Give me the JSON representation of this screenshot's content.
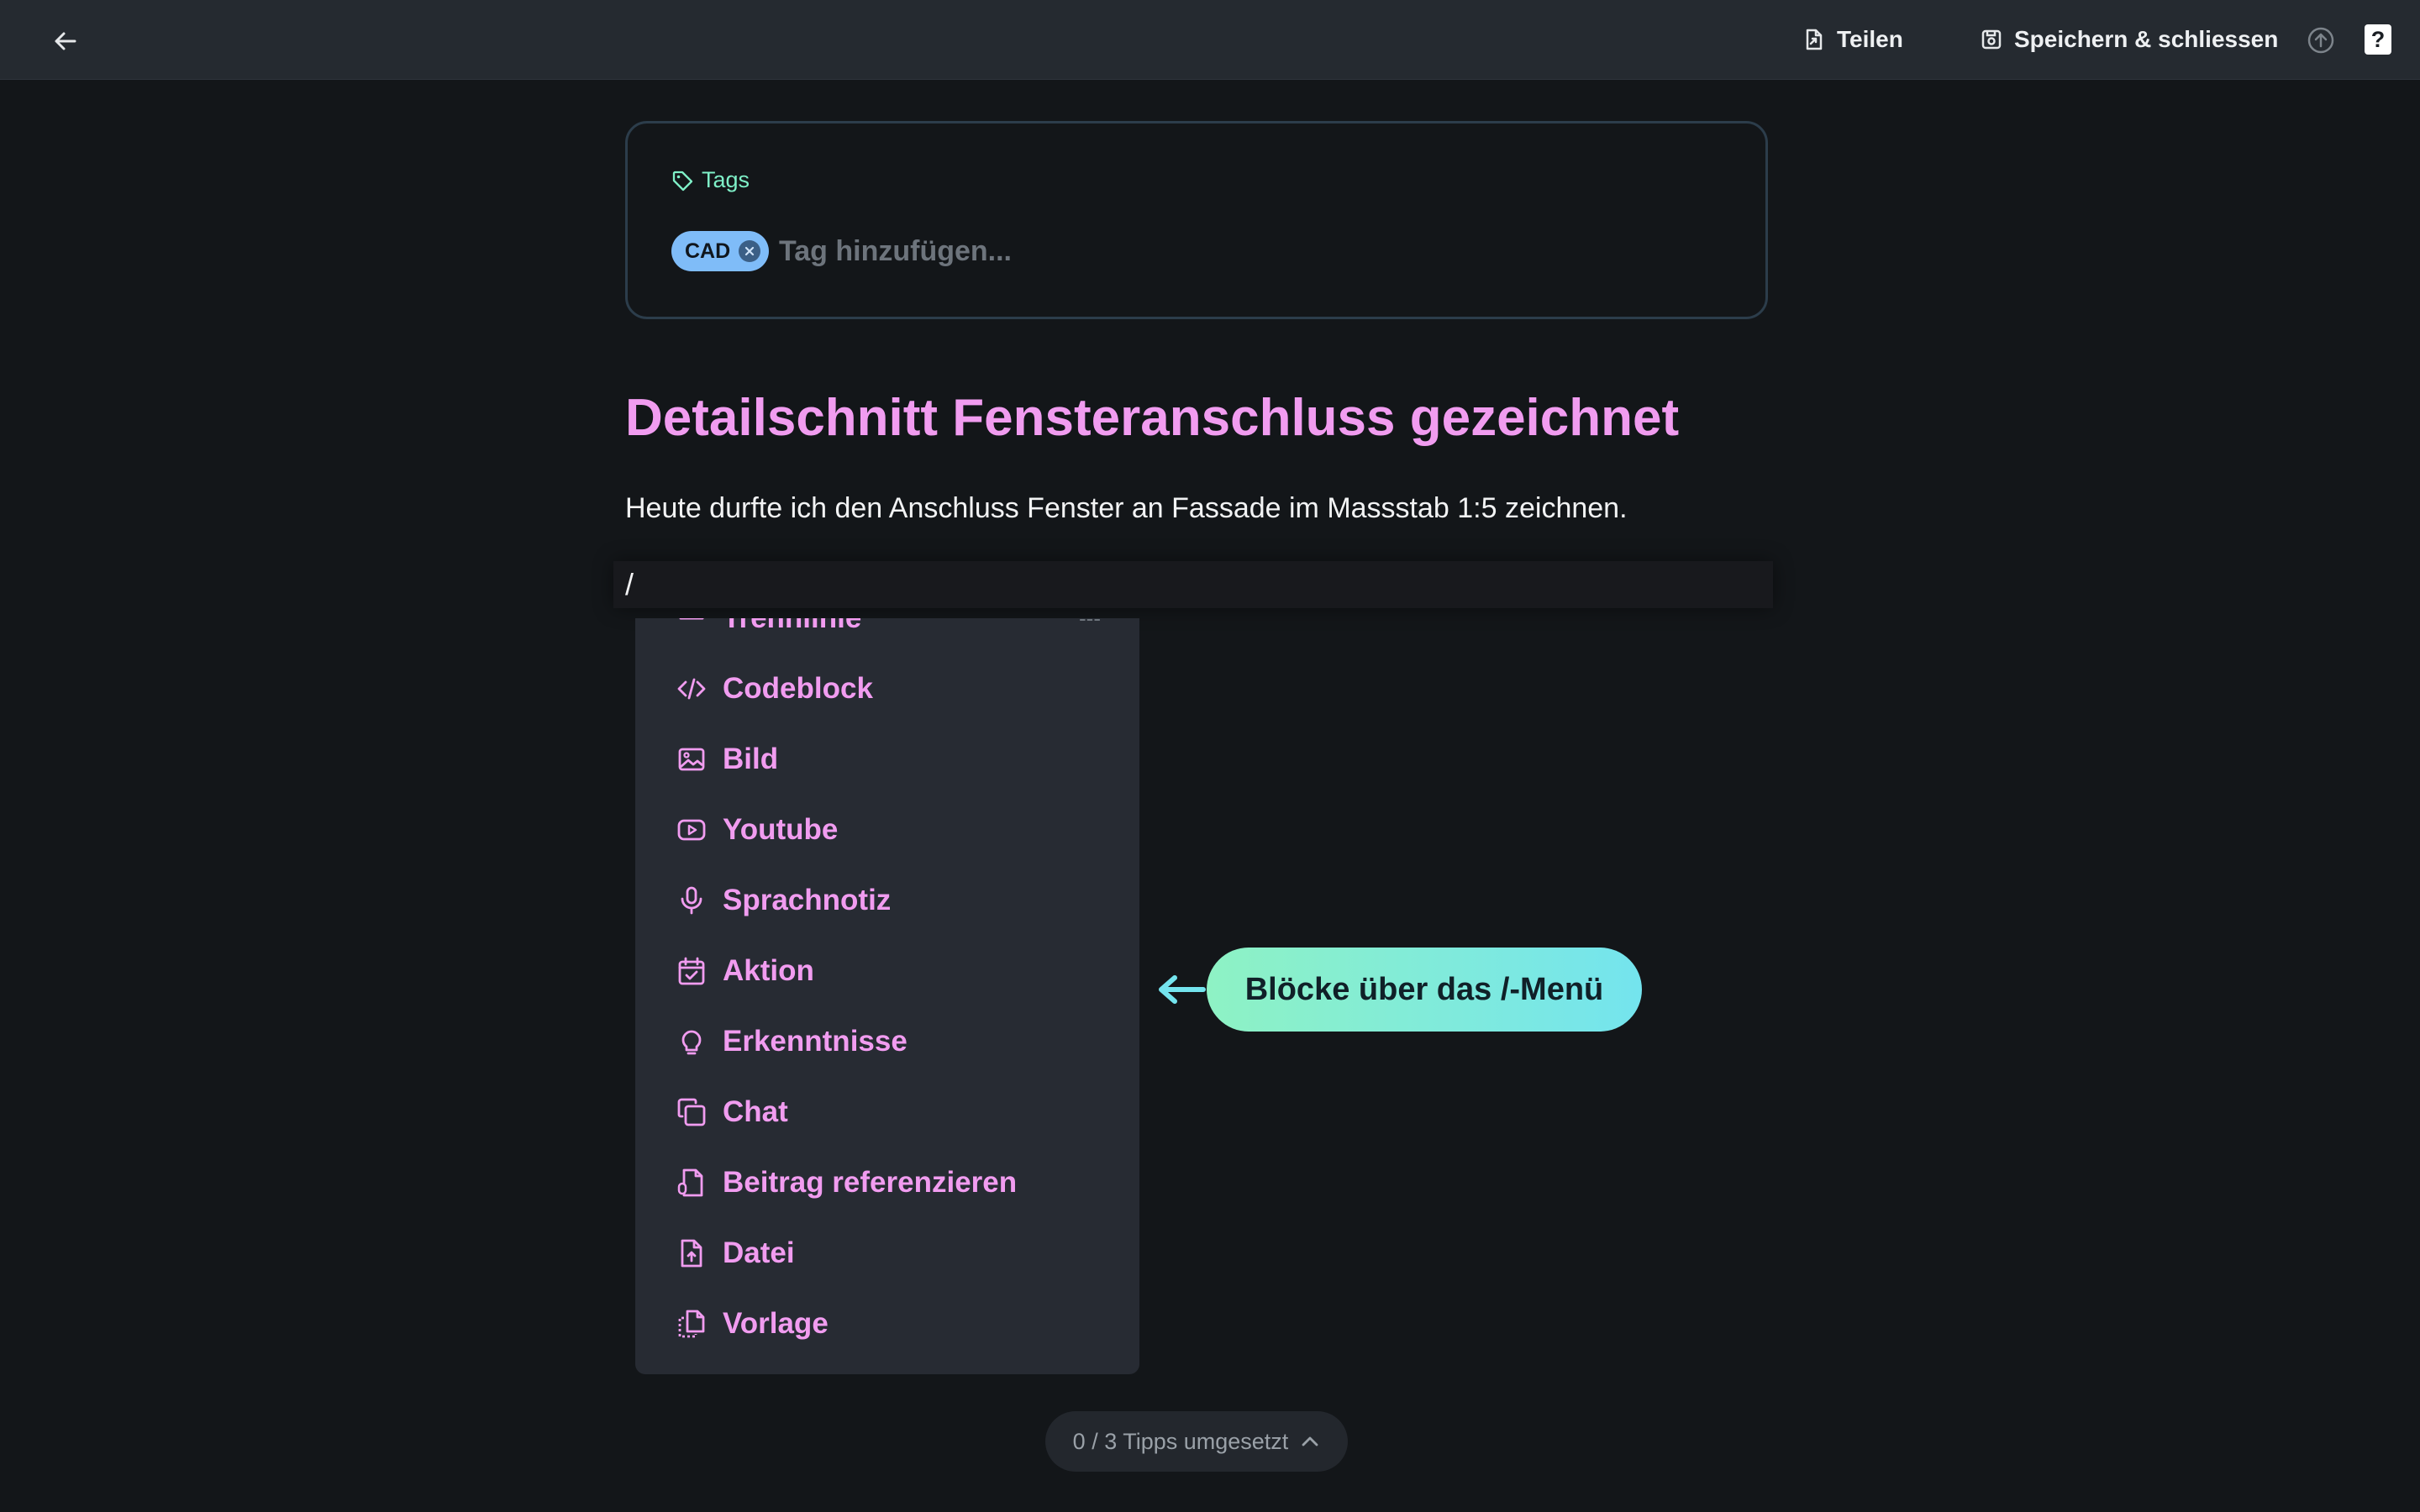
{
  "topbar": {
    "back_icon": "arrow-left-icon",
    "share_label": "Teilen",
    "share_icon": "file-share-icon",
    "save_label": "Speichern & schliessen",
    "save_icon": "save-icon",
    "upload_icon": "arrow-up-circle-icon",
    "help_label": "?"
  },
  "tags": {
    "label": "Tags",
    "icon": "tag-icon",
    "items": [
      {
        "label": "CAD"
      }
    ],
    "input_placeholder": "Tag hinzufügen..."
  },
  "document": {
    "title": "Detailschnitt Fensteranschluss gezeichnet",
    "paragraph": "Heute durfte ich den Anschluss Fenster an Fassade im Massstab 1:5 zeichnen.",
    "current_line": "/"
  },
  "slash_menu": {
    "items": [
      {
        "label": "Trennlinie",
        "icon": "divider-icon",
        "shortcut": "---"
      },
      {
        "label": "Codeblock",
        "icon": "code-icon"
      },
      {
        "label": "Bild",
        "icon": "image-icon"
      },
      {
        "label": "Youtube",
        "icon": "youtube-icon"
      },
      {
        "label": "Sprachnotiz",
        "icon": "microphone-icon"
      },
      {
        "label": "Aktion",
        "icon": "calendar-check-icon"
      },
      {
        "label": "Erkenntnisse",
        "icon": "lightbulb-icon"
      },
      {
        "label": "Chat",
        "icon": "chat-copy-icon"
      },
      {
        "label": "Beitrag referenzieren",
        "icon": "file-link-icon"
      },
      {
        "label": "Datei",
        "icon": "file-upload-icon"
      },
      {
        "label": "Vorlage",
        "icon": "template-icon"
      }
    ]
  },
  "tip": {
    "text": "Blöcke über das /-Menü",
    "arrow_icon": "arrow-left-icon"
  },
  "tips_counter": {
    "label": "0 / 3 Tipps umgesetzt",
    "icon": "chevron-up-icon"
  },
  "colors": {
    "accent_pink": "#f19cf0",
    "accent_mint": "#7ff0c8",
    "tag_blue": "#7fbcf8",
    "background": "#131619",
    "topbar": "#252a30",
    "menu": "#272b33"
  }
}
